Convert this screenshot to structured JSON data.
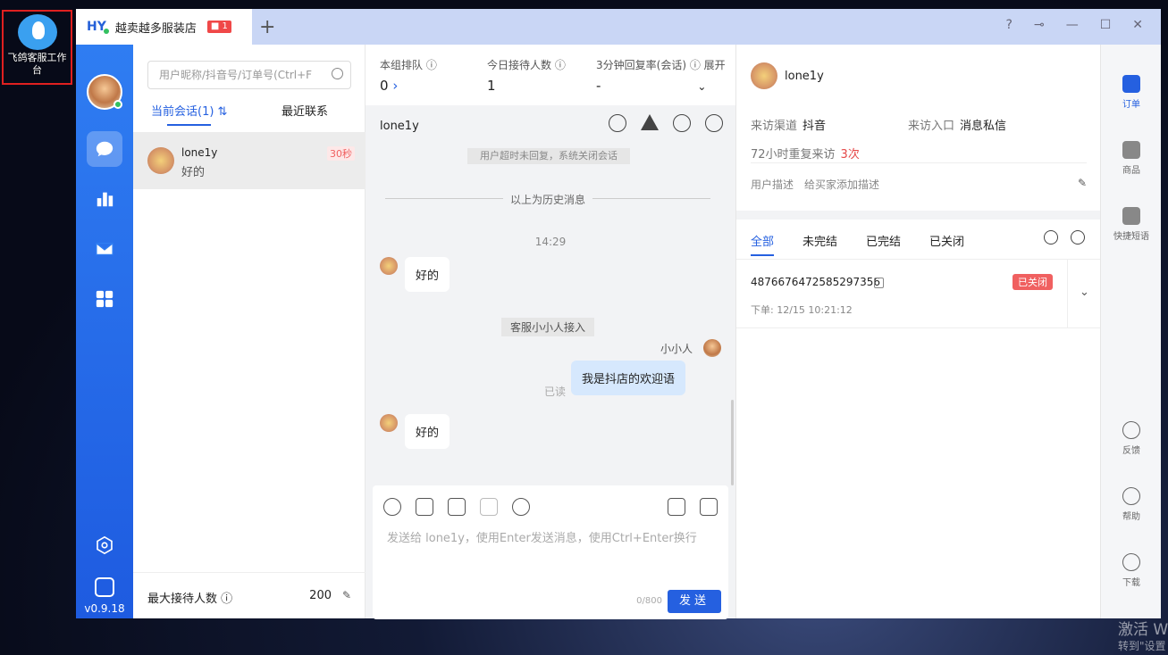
{
  "desktop": {
    "icon_label": "飞鸽客服工作台",
    "watermark_line1": "激活 W",
    "watermark_line2": "转到\"设置"
  },
  "titlebar": {
    "tab_logo": "HY",
    "tab_name": "越卖越多服装店",
    "tab_badge": "1",
    "add_tab": "+"
  },
  "nav": {
    "version": "v0.9.18",
    "items": [
      "chat-icon",
      "chart-icon",
      "mail-icon",
      "apps-icon"
    ],
    "settings_icon": "settings-icon"
  },
  "convlist": {
    "search_placeholder": "用户昵称/抖音号/订单号(Ctrl+F",
    "tab_current": "当前会话(1)",
    "tab_recent": "最近联系",
    "items": [
      {
        "name": "lone1y",
        "last_msg": "好的",
        "wait": "30秒"
      }
    ],
    "max_label": "最大接待人数",
    "max_value": "200"
  },
  "stats": {
    "queue_label": "本组排队",
    "queue_value": "0",
    "today_label": "今日接待人数",
    "today_value": "1",
    "reply_label": "3分钟回复率(会话)",
    "reply_value": "-",
    "expand": "展开"
  },
  "chat": {
    "name": "lone1y",
    "sys_notice": "用户超时未回复，系统关闭会话",
    "history_divider": "以上为历史消息",
    "time": "14:29",
    "msg1": "好的",
    "join_notice": "客服小小人接入",
    "agent_name": "小小人",
    "agent_msg": "我是抖店的欢迎语",
    "read": "已读",
    "msg2": "好的",
    "placeholder": "发送给 lone1y，使用Enter发送消息，使用Ctrl+Enter换行",
    "counter": "0/800",
    "send": "发送"
  },
  "panel": {
    "name": "lone1y",
    "channel_label": "来访渠道",
    "channel_value": "抖音",
    "entry_label": "来访入口",
    "entry_value": "消息私信",
    "repeat_label": "72小时重复来访",
    "repeat_value": "3次",
    "desc_label": "用户描述",
    "desc_placeholder": "给买家添加描述",
    "order_tabs": [
      "全部",
      "未完结",
      "已完结",
      "已关闭"
    ],
    "order": {
      "id": "4876676472585297356",
      "status": "已关闭",
      "date": "下单: 12/15 10:21:12"
    }
  },
  "rside": {
    "items": [
      {
        "label": "订单",
        "icon": "order-icon"
      },
      {
        "label": "商品",
        "icon": "goods-icon"
      },
      {
        "label": "快捷短语",
        "icon": "send-icon"
      },
      {
        "label": "反馈",
        "icon": "feedback-icon"
      },
      {
        "label": "帮助",
        "icon": "help-icon"
      },
      {
        "label": "下载",
        "icon": "download-icon"
      }
    ]
  },
  "colors": {
    "primary": "#2560e0",
    "nav": "#2f7df2",
    "danger": "#f06060"
  }
}
